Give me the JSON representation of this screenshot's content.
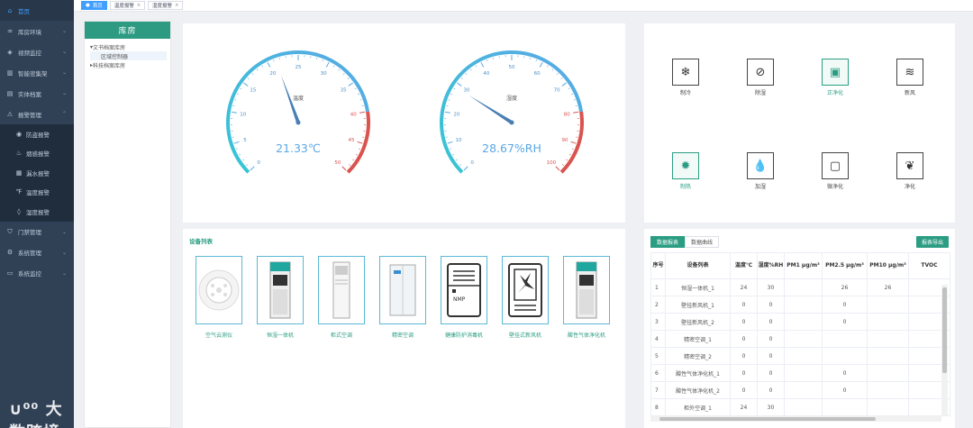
{
  "sidebar": {
    "items": [
      {
        "label": "首页",
        "icon": "home-icon",
        "glyph": "⌂",
        "active": true,
        "arrow": false
      },
      {
        "label": "库房环境",
        "icon": "environment-icon",
        "glyph": "♒",
        "arrow": true
      },
      {
        "label": "视频监控",
        "icon": "camera-icon",
        "glyph": "◈",
        "arrow": true
      },
      {
        "label": "智能密集架",
        "icon": "shelf-icon",
        "glyph": "▥",
        "arrow": true
      },
      {
        "label": "实体档案",
        "icon": "archive-icon",
        "glyph": "▤",
        "arrow": true
      },
      {
        "label": "报警管理",
        "icon": "alarm-icon",
        "glyph": "⚠",
        "arrow": true,
        "expanded": true
      }
    ],
    "sub_items": [
      {
        "label": "防盗报警",
        "icon": "guard-icon",
        "glyph": "◉"
      },
      {
        "label": "烟感报警",
        "icon": "smoke-icon",
        "glyph": "♨"
      },
      {
        "label": "漏水报警",
        "icon": "water-leak-icon",
        "glyph": "▦"
      },
      {
        "label": "温度报警",
        "icon": "temperature-icon",
        "glyph": "℉"
      },
      {
        "label": "湿度报警",
        "icon": "humidity-icon",
        "glyph": "◊"
      }
    ],
    "items2": [
      {
        "label": "门禁管理",
        "icon": "door-icon",
        "glyph": "⛉"
      },
      {
        "label": "系统管理",
        "icon": "settings-icon",
        "glyph": "⚙"
      },
      {
        "label": "系统监控",
        "icon": "monitor-icon",
        "glyph": "▭"
      }
    ],
    "watermark": "大数跨境"
  },
  "tabs_bar": [
    {
      "label": "首页",
      "active": true
    },
    {
      "label": "温度报警",
      "closable": true
    },
    {
      "label": "湿度报警",
      "closable": true
    }
  ],
  "tree": {
    "title": "库房",
    "nodes": [
      {
        "label": "文书档案库房",
        "level": 0,
        "expanded": true
      },
      {
        "label": "区域控制器",
        "level": 1,
        "selected": true
      },
      {
        "label": "科技档案库房",
        "level": 0,
        "expanded": false
      }
    ]
  },
  "gauges": [
    {
      "name": "温度",
      "value": 21.33,
      "display": "21.33℃",
      "min": 0,
      "max": 50,
      "ticks": [
        "0",
        "5",
        "10",
        "15",
        "20",
        "25",
        "30",
        "35",
        "40",
        "45",
        "50"
      ],
      "warn_from": 40
    },
    {
      "name": "湿度",
      "value": 28.67,
      "display": "28.67%RH",
      "min": 0,
      "max": 100,
      "ticks": [
        "0",
        "10",
        "20",
        "30",
        "40",
        "50",
        "60",
        "70",
        "80",
        "90",
        "100"
      ],
      "warn_from": 80
    }
  ],
  "devices": [
    {
      "label": "制冷",
      "icon": "snowflake-icon",
      "glyph": "❄",
      "active": false
    },
    {
      "label": "除湿",
      "icon": "dehumidify-icon",
      "glyph": "⊘",
      "active": false
    },
    {
      "label": "正净化",
      "icon": "positive-purify-icon",
      "glyph": "▣",
      "active": true
    },
    {
      "label": "新风",
      "icon": "fresh-air-icon",
      "glyph": "≋",
      "active": false
    },
    {
      "label": "制热",
      "icon": "sun-icon",
      "glyph": "✹",
      "active": true
    },
    {
      "label": "加湿",
      "icon": "droplets-icon",
      "glyph": "💧",
      "active": false
    },
    {
      "label": "微净化",
      "icon": "micro-purify-icon",
      "glyph": "▢",
      "active": false
    },
    {
      "label": "净化",
      "icon": "leaf-icon",
      "glyph": "❦",
      "active": false
    }
  ],
  "equipment": {
    "title": "设备列表",
    "items": [
      {
        "label": "空气云测仪",
        "icon": "air-sensor-icon"
      },
      {
        "label": "恒湿一体机",
        "icon": "humidifier-unit-icon"
      },
      {
        "label": "柜式空调",
        "icon": "cabinet-ac-icon"
      },
      {
        "label": "精密空调",
        "icon": "precision-ac-icon"
      },
      {
        "label": "健康防护消毒机",
        "icon": "disinfection-icon",
        "sign": "NMP"
      },
      {
        "label": "壁挂式新风机",
        "icon": "wall-fan-icon"
      },
      {
        "label": "酸性气体净化机",
        "icon": "acid-purifier-icon"
      }
    ]
  },
  "table_panel": {
    "tabs": [
      {
        "label": "数据报表",
        "active": true
      },
      {
        "label": "数据曲线",
        "active": false
      }
    ],
    "export": "报表导出",
    "headers": [
      "序号",
      "设备列表",
      "温度℃",
      "湿度%RH",
      "PM1 μg/m³",
      "PM2.5 μg/m³",
      "PM10 μg/m³",
      "TVOC"
    ],
    "rows": [
      [
        "1",
        "恒湿一体机_1",
        "24",
        "30",
        "",
        "26",
        "26",
        ""
      ],
      [
        "2",
        "壁挂新风机_1",
        "0",
        "0",
        "",
        "0",
        "",
        ""
      ],
      [
        "3",
        "壁挂新风机_2",
        "0",
        "0",
        "",
        "0",
        "",
        ""
      ],
      [
        "4",
        "精密空调_1",
        "0",
        "0",
        "",
        "",
        "",
        ""
      ],
      [
        "5",
        "精密空调_2",
        "0",
        "0",
        "",
        "",
        "",
        ""
      ],
      [
        "6",
        "酸性气体净化机_1",
        "0",
        "0",
        "",
        "0",
        "",
        ""
      ],
      [
        "7",
        "酸性气体净化机_2",
        "0",
        "0",
        "",
        "0",
        "",
        ""
      ],
      [
        "8",
        "柜外空调_1",
        "24",
        "30",
        "",
        "",
        "",
        ""
      ]
    ]
  },
  "colors": {
    "accent": "#2a9d82",
    "sidebar": "#304156",
    "gauge_start": "#36c6d3",
    "gauge_mid": "#5aa8e6",
    "gauge_warn": "#d9534f"
  }
}
